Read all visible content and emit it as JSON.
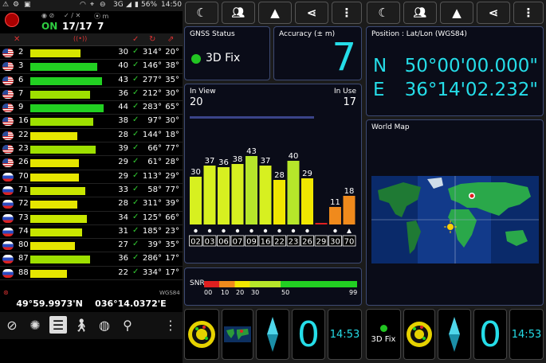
{
  "status_bar": {
    "time": "14:50",
    "battery": "56%",
    "network": "3G"
  },
  "left": {
    "gps_state": "ON",
    "sats_used": "17/17",
    "sats_m": "7",
    "columns": [
      "✕",
      "((•))",
      "✓",
      "↻",
      "⇗"
    ],
    "rows": [
      {
        "flag": "us",
        "prn": "2",
        "snr": "30",
        "az": "314°",
        "el": "20°",
        "color": "#d7e600"
      },
      {
        "flag": "us",
        "prn": "3",
        "snr": "40",
        "az": "146°",
        "el": "38°",
        "color": "#22d022"
      },
      {
        "flag": "us",
        "prn": "6",
        "snr": "43",
        "az": "277°",
        "el": "35°",
        "color": "#22d022"
      },
      {
        "flag": "us",
        "prn": "7",
        "snr": "36",
        "az": "212°",
        "el": "30°",
        "color": "#9ee000"
      },
      {
        "flag": "us",
        "prn": "9",
        "snr": "44",
        "az": "283°",
        "el": "65°",
        "color": "#22d022"
      },
      {
        "flag": "us",
        "prn": "16",
        "snr": "38",
        "az": "97°",
        "el": "30°",
        "color": "#9ee000"
      },
      {
        "flag": "us",
        "prn": "22",
        "snr": "28",
        "az": "144°",
        "el": "18°",
        "color": "#e6e600"
      },
      {
        "flag": "us",
        "prn": "23",
        "snr": "39",
        "az": "66°",
        "el": "77°",
        "color": "#9ee000"
      },
      {
        "flag": "us",
        "prn": "26",
        "snr": "29",
        "az": "61°",
        "el": "28°",
        "color": "#e6e600"
      },
      {
        "flag": "ru",
        "prn": "70",
        "snr": "29",
        "az": "113°",
        "el": "29°",
        "color": "#e6e600"
      },
      {
        "flag": "ru",
        "prn": "71",
        "snr": "33",
        "az": "58°",
        "el": "77°",
        "color": "#c8e600"
      },
      {
        "flag": "ru",
        "prn": "72",
        "snr": "28",
        "az": "311°",
        "el": "39°",
        "color": "#e6e600"
      },
      {
        "flag": "ru",
        "prn": "73",
        "snr": "34",
        "az": "125°",
        "el": "66°",
        "color": "#c8e600"
      },
      {
        "flag": "ru",
        "prn": "74",
        "snr": "31",
        "az": "185°",
        "el": "23°",
        "color": "#c8e600"
      },
      {
        "flag": "ru",
        "prn": "80",
        "snr": "27",
        "az": "39°",
        "el": "35°",
        "color": "#e6e600"
      },
      {
        "flag": "ru",
        "prn": "87",
        "snr": "36",
        "az": "286°",
        "el": "17°",
        "color": "#9ee000"
      },
      {
        "flag": "ru",
        "prn": "88",
        "snr": "22",
        "az": "334°",
        "el": "17°",
        "color": "#e6e600"
      }
    ],
    "datum": "WGS84",
    "coordinates": "49°59.9973'N    036°14.0372'E",
    "nav_icons": [
      "compass",
      "radar",
      "list",
      "walk",
      "globe",
      "pin",
      "more"
    ]
  },
  "middle": {
    "gnss_status_label": "GNSS Status",
    "fix": "3D Fix",
    "accuracy_label": "Accuracy (± m)",
    "accuracy": "7",
    "in_view_label": "In View",
    "in_view": "20",
    "in_use_label": "In Use",
    "in_use": "17",
    "snr_label": "SNR",
    "snr_ticks": [
      "00",
      "10",
      "20",
      "30",
      "50",
      "99"
    ],
    "tile_zero": "0",
    "tile_time": "14:53"
  },
  "chart_data": {
    "type": "bar",
    "categories": [
      "02",
      "03",
      "06",
      "07",
      "09",
      "16",
      "22",
      "23",
      "26",
      "29",
      "30",
      "70"
    ],
    "values": [
      30,
      37,
      36,
      38,
      43,
      37,
      28,
      40,
      29,
      1,
      11,
      18
    ],
    "colors": [
      "#d7f020",
      "#d7f020",
      "#d7f020",
      "#d7f020",
      "#b6e62a",
      "#d7f020",
      "#f0e600",
      "#b6e62a",
      "#f0e600",
      "#e02020",
      "#f08a1c",
      "#f08a1c"
    ],
    "markers": [
      "dot",
      "dot",
      "dot",
      "dot",
      "dot",
      "dot",
      "dot",
      "dot",
      "dot",
      "",
      "dot",
      "triangle"
    ]
  },
  "right": {
    "position_label": "Position : Lat/Lon (WGS84)",
    "lat_hemi": "N",
    "lat": "50°00'00.000\"",
    "lon_hemi": "E",
    "lon": "36°14'02.232\"",
    "world_map_label": "World Map",
    "tile_fix": "3D Fix",
    "tile_zero": "0",
    "tile_time": "14:53"
  }
}
